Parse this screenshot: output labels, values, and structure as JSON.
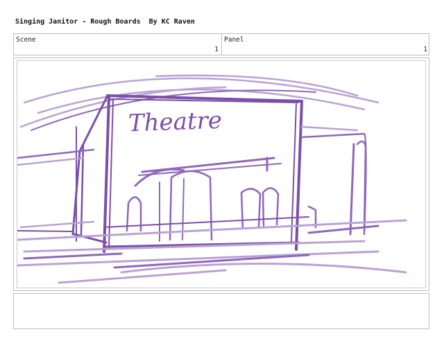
{
  "document": {
    "title": "Singing Janitor - Rough Boards  By KC Raven"
  },
  "header": {
    "scene_label": "Scene",
    "scene_value": "1",
    "panel_label": "Panel",
    "panel_value": "1"
  },
  "sketch": {
    "sign_text": "Theatre",
    "stroke_color": "#7a4fa8",
    "light_stroke_color": "#b9a2d4"
  }
}
